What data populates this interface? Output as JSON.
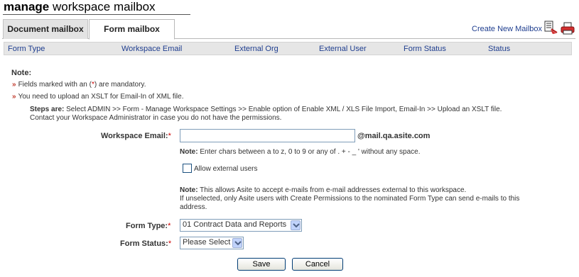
{
  "title": {
    "bold": "manage",
    "rest": "workspace mailbox"
  },
  "tabs": [
    {
      "label": "Document mailbox",
      "active": false
    },
    {
      "label": "Form mailbox",
      "active": true
    }
  ],
  "toolbar": {
    "create_link": "Create New Mailbox",
    "icons": [
      "new-mailbox-icon",
      "print-icon"
    ]
  },
  "columns": [
    "Form Type",
    "Workspace Email",
    "External Org",
    "External User",
    "Form Status",
    "Status"
  ],
  "note": {
    "title": "Note:",
    "bullet1_pre": "Fields marked with an (",
    "bullet1_star": "*",
    "bullet1_post": ") are mandatory.",
    "bullet2": "You need to upload an XSLT for Email-In of XML file.",
    "steps_label": "Steps are:",
    "steps_text": " Select  ADMIN  >>  Form - Manage Workspace Settings  >>  Enable option of Enable XML / XLS File Import, Email-In  >>  Upload an XSLT file.",
    "steps_line2": "Contact your Workspace Administrator in case you do not have the permissions."
  },
  "form": {
    "email_label": "Workspace Email:",
    "email_value": "",
    "domain": "@mail.qa.asite.com",
    "email_hint_label": "Note:",
    "email_hint": " Enter chars between a to z, 0 to 9 or any of . + - _ ' without any space.",
    "external_label": "Allow external users",
    "external_checked": false,
    "external_note_label": "Note:",
    "external_note_1": " This allows Asite to accept e-mails from e-mail addresses external to this workspace.",
    "external_note_2": "If unselected, only Asite users with Create Permissions to the nominated Form Type can send e-mails to this",
    "external_note_3": "address.",
    "form_type_label": "Form Type:",
    "form_type_value": "01 Contract Data and Reports",
    "form_status_label": "Form Status:",
    "form_status_value": "Please Select"
  },
  "buttons": {
    "save": "Save",
    "cancel": "Cancel"
  },
  "colors": {
    "link": "#1f3e8f",
    "required": "#cc0000",
    "header_bg": "#e6e6e6"
  }
}
